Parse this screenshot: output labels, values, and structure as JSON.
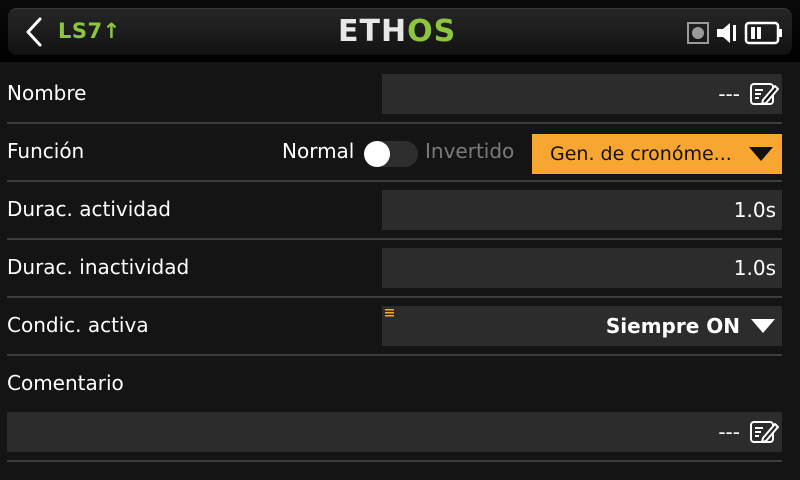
{
  "header": {
    "page_id": "LS7",
    "logo_left": "ETH",
    "logo_right": "OS",
    "icons": [
      "back-icon",
      "sd-card-icon",
      "speaker-icon",
      "battery-icon"
    ]
  },
  "fields": {
    "name": {
      "label": "Nombre",
      "value": "---"
    },
    "function": {
      "label": "Función",
      "mode_normal": "Normal",
      "mode_inverted": "Invertido",
      "inverted": false,
      "value": "Gen. de cronóme..."
    },
    "active_duration": {
      "label": "Durac. actividad",
      "value": "1.0s"
    },
    "inactive_duration": {
      "label": "Durac. inactividad",
      "value": "1.0s"
    },
    "active_condition": {
      "label": "Condic. activa",
      "value": "Siempre ON"
    },
    "comment": {
      "label": "Comentario",
      "value": "---"
    }
  },
  "colors": {
    "accent_green": "#8cc63f",
    "accent_orange": "#f7a632",
    "background": "#141414",
    "field_bg": "#2c2c2c"
  }
}
